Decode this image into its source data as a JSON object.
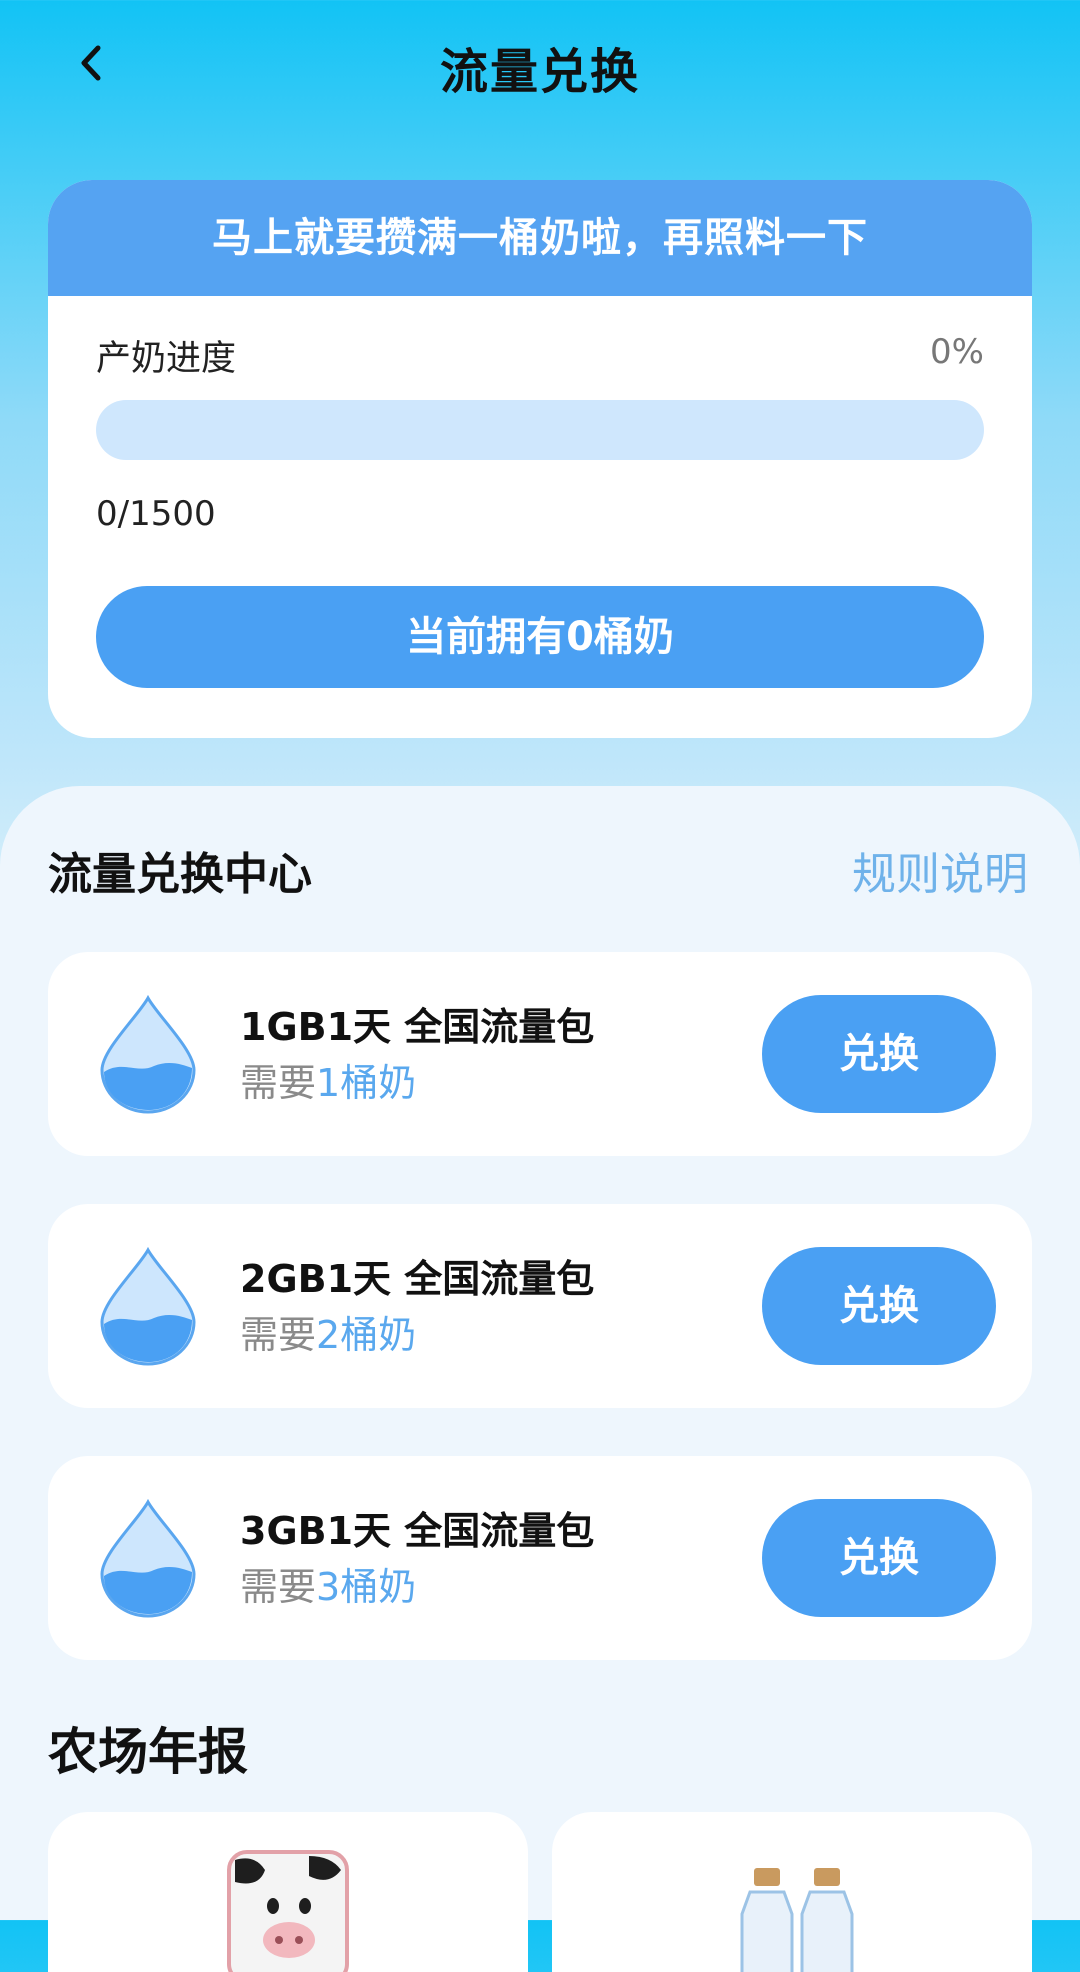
{
  "header": {
    "title": "流量兑换"
  },
  "progress_card": {
    "banner_text": "马上就要攒满一桶奶啦，再照料一下",
    "label": "产奶进度",
    "percent_text": "0%",
    "progress_fraction": 0,
    "count_text": "0/1500",
    "owned_button": "当前拥有0桶奶"
  },
  "exchange_center": {
    "title": "流量兑换中心",
    "rules_link": "规则说明",
    "items": [
      {
        "title": "1GB1天 全国流量包",
        "req_prefix": "需要",
        "req_amount": "1桶奶",
        "button": "兑换"
      },
      {
        "title": "2GB1天 全国流量包",
        "req_prefix": "需要",
        "req_amount": "2桶奶",
        "button": "兑换"
      },
      {
        "title": "3GB1天 全国流量包",
        "req_prefix": "需要",
        "req_amount": "3桶奶",
        "button": "兑换"
      }
    ]
  },
  "farm_report": {
    "title": "农场年报"
  },
  "colors": {
    "accent": "#4aa0f3",
    "banner": "#55a3f2",
    "link": "#6fb2ea",
    "track": "#cfe7fd"
  },
  "icons": {
    "back": "chevron-left-icon",
    "item": "water-drop-icon",
    "report_left": "cow-box-icon",
    "report_right": "milk-bottles-icon"
  }
}
